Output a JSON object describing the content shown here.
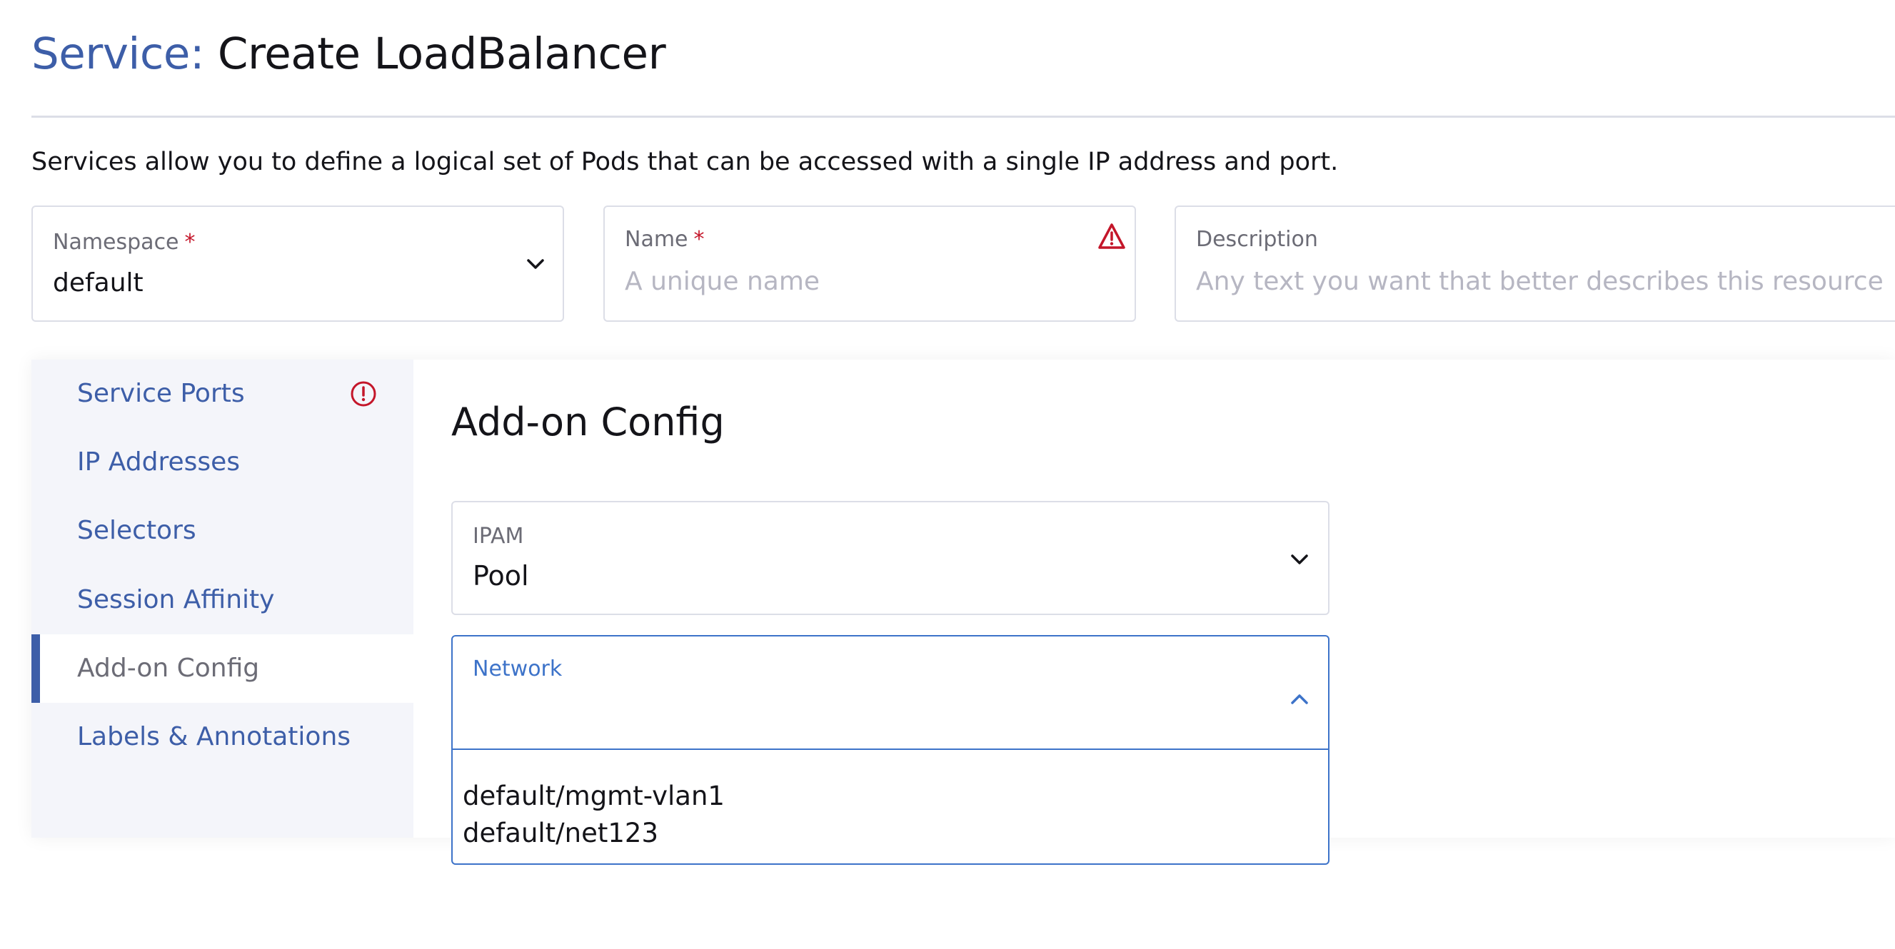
{
  "header": {
    "kind": "Service:",
    "title": "Create LoadBalancer",
    "description": "Services allow you to define a logical set of Pods that can be accessed with a single IP address and port."
  },
  "fields": {
    "namespace": {
      "label": "Namespace",
      "required_mark": "*",
      "value": "default"
    },
    "name": {
      "label": "Name",
      "required_mark": "*",
      "placeholder": "A unique name",
      "status": "warning-icon"
    },
    "description": {
      "label": "Description",
      "placeholder": "Any text you want that better describes this resource"
    }
  },
  "tabs": [
    {
      "label": "Service Ports",
      "has_error": true
    },
    {
      "label": "IP Addresses"
    },
    {
      "label": "Selectors"
    },
    {
      "label": "Session Affinity"
    },
    {
      "label": "Add-on Config",
      "active": true
    },
    {
      "label": "Labels & Annotations"
    }
  ],
  "addon_config": {
    "title": "Add-on Config",
    "ipam": {
      "label": "IPAM",
      "value": "Pool"
    },
    "network": {
      "label": "Network",
      "value": "",
      "options": [
        "default/mgmt-vlan1",
        "default/net123"
      ]
    }
  },
  "colors": {
    "accent": "#3d5ea8",
    "focus": "#3d73c9",
    "error": "#c4162a",
    "border": "#dcdee7",
    "sidebar_bg": "#f4f5fa"
  }
}
